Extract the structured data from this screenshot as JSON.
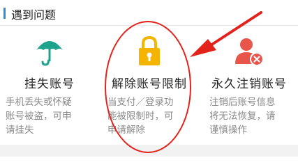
{
  "section": {
    "title": "遇到问题"
  },
  "cards": [
    {
      "title": "挂失账号",
      "description": "手机丢失或怀疑\n账号被盗，可申\n请挂失",
      "icon": "umbrella-icon",
      "icon_color": "#1fa38c"
    },
    {
      "title": "解除账号限制",
      "description": "当支付／登录功\n能被限制时，可\n申请解除",
      "icon": "lock-icon",
      "icon_color": "#f5b400"
    },
    {
      "title": "永久注销账号",
      "description": "注销后账号信息\n将无法恢复，请\n谨慎操作",
      "icon": "user-remove-icon",
      "icon_color": "#e8554a"
    }
  ],
  "annotation": {
    "color": "#e3231b"
  }
}
